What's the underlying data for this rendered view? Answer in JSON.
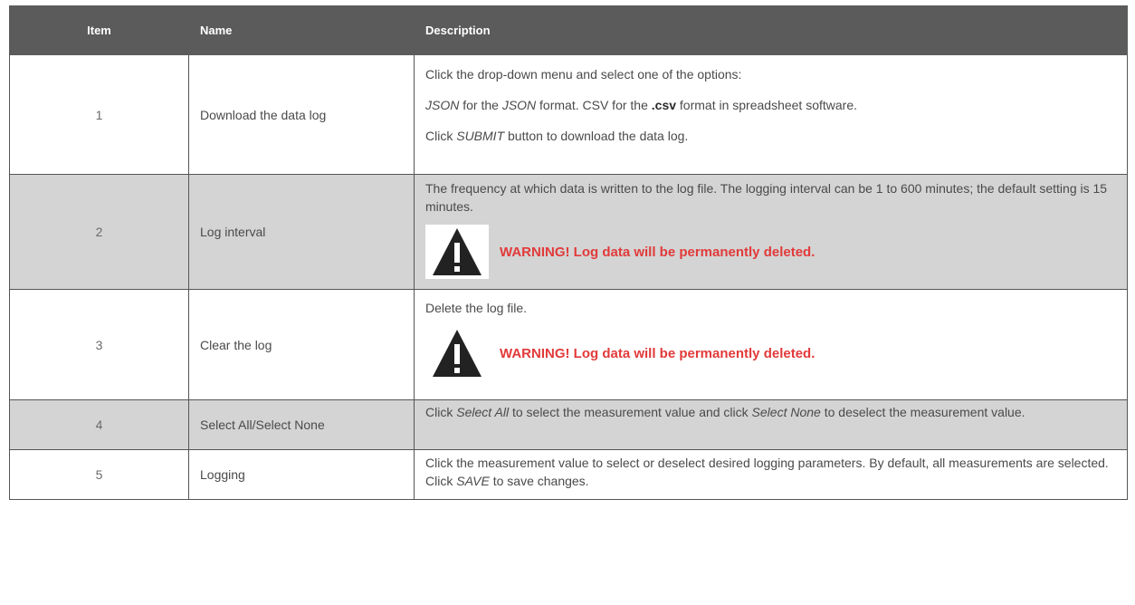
{
  "headers": {
    "item": "Item",
    "name": "Name",
    "description": "Description"
  },
  "rows": [
    {
      "item": "1",
      "name": "Download the data log",
      "desc": {
        "line1": "Click the drop-down menu and select one of the options:",
        "line2_json1": "JSON",
        "line2_mid": " for the ",
        "line2_json2": "JSON",
        "line2_after": " format. CSV for the ",
        "line2_csv": ".csv",
        "line2_end": " format in spreadsheet software.",
        "line3_pre": "Click ",
        "line3_submit": "SUBMIT",
        "line3_end": " button to download the data log."
      }
    },
    {
      "item": "2",
      "name": "Log interval",
      "desc": {
        "text": "The frequency at which data is written to the log file. The logging interval can be 1 to 600 minutes; the default setting is 15 minutes.",
        "warning": "WARNING! Log data will be permanently deleted."
      }
    },
    {
      "item": "3",
      "name": "Clear the log",
      "desc": {
        "text": "Delete the log file.",
        "warning": "WARNING! Log data will be permanently deleted."
      }
    },
    {
      "item": "4",
      "name": "Select All/Select None",
      "desc": {
        "pre": "Click ",
        "sel_all": "Select All",
        "mid": " to select the measurement value and click ",
        "sel_none": "Select None",
        "end": " to deselect the measurement value."
      }
    },
    {
      "item": "5",
      "name": "Logging",
      "desc": {
        "pre": "Click the measurement value to select or deselect desired logging parameters. By default, all measurements are selected. Click ",
        "save": "SAVE",
        "end": " to save changes."
      }
    }
  ],
  "icons": {
    "warning": "warning-triangle-icon"
  },
  "colors": {
    "header_bg": "#5b5b5b",
    "shaded_row": "#d4d4d4",
    "warning_text": "#e23a3a"
  }
}
